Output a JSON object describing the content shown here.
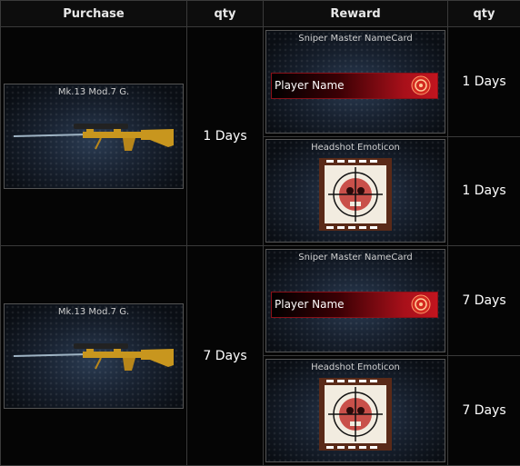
{
  "headers": {
    "purchase": "Purchase",
    "qty": "qty",
    "reward": "Reward",
    "qty2": "qty"
  },
  "rows": [
    {
      "item_name": "Mk.13 Mod.7 G.",
      "qty": "1 Days",
      "rewards": [
        {
          "title": "Sniper Master NameCard",
          "player_name": "Player Name",
          "qty": "1 Days"
        },
        {
          "title": "Headshot Emoticon",
          "qty": "1 Days"
        }
      ]
    },
    {
      "item_name": "Mk.13 Mod.7 G.",
      "qty": "7 Days",
      "rewards": [
        {
          "title": "Sniper Master NameCard",
          "player_name": "Player Name",
          "qty": "7 Days"
        },
        {
          "title": "Headshot Emoticon",
          "qty": "7 Days"
        }
      ]
    }
  ],
  "colors": {
    "namecard_red": "#c2151f",
    "gold": "#c8961e",
    "card_blue": "#2a3b52"
  },
  "icons": [
    "sniper-rifle-icon",
    "crosshair-emblem-icon",
    "headshot-skull-icon"
  ]
}
